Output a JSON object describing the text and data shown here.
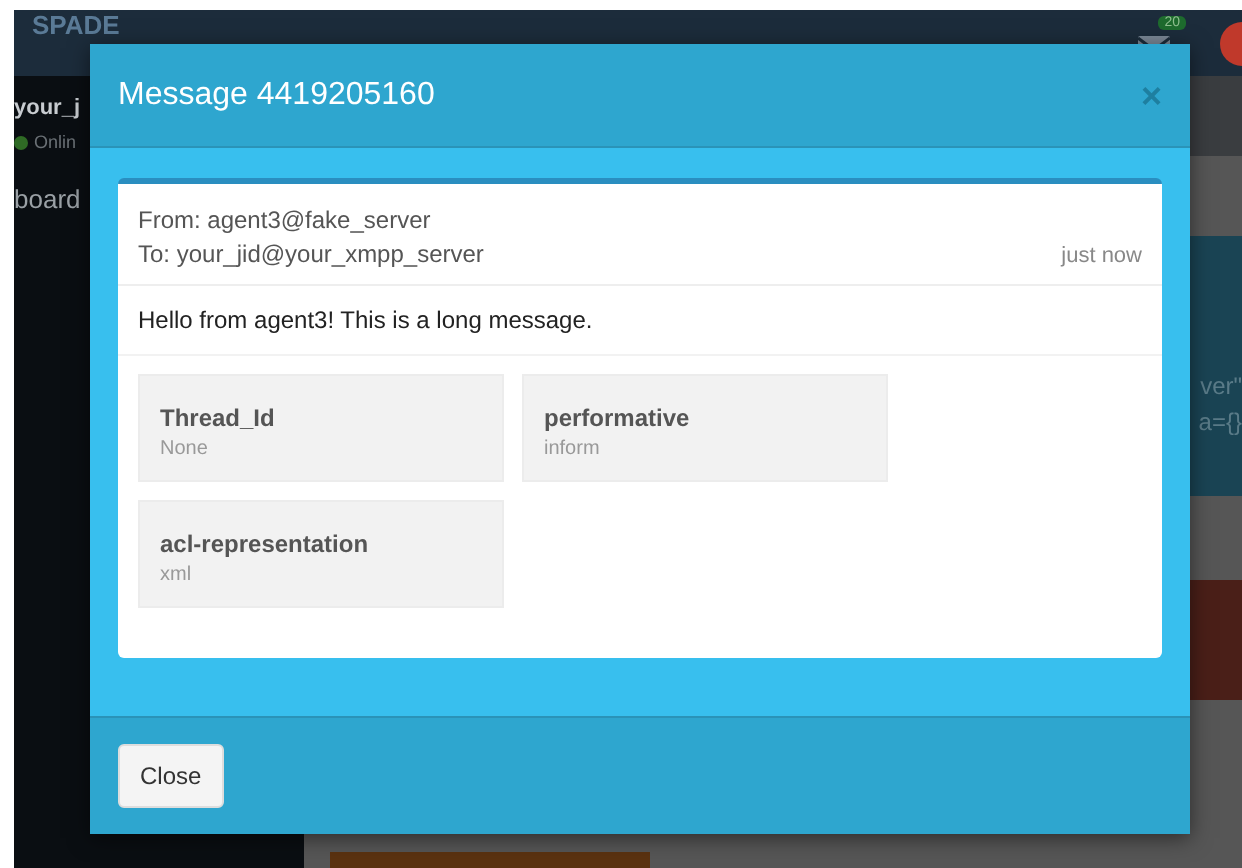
{
  "background": {
    "brand": "SPADE",
    "mail_badge": "20",
    "user": "your_j",
    "status": "Onlin",
    "online": true,
    "nav_item": "board",
    "code_lines": [
      "ver\"",
      "a={}"
    ]
  },
  "modal": {
    "title": "Message 4419205160",
    "close_glyph": "×",
    "from": "From: agent3@fake_server",
    "to": "To: your_jid@your_xmpp_server",
    "time": "just now",
    "body": "Hello from agent3! This is a long message.",
    "fields": [
      {
        "name": "Thread_Id",
        "value": "None"
      },
      {
        "name": "performative",
        "value": "inform"
      },
      {
        "name": "acl-representation",
        "value": "xml"
      }
    ],
    "buttons": [
      "Close"
    ]
  }
}
